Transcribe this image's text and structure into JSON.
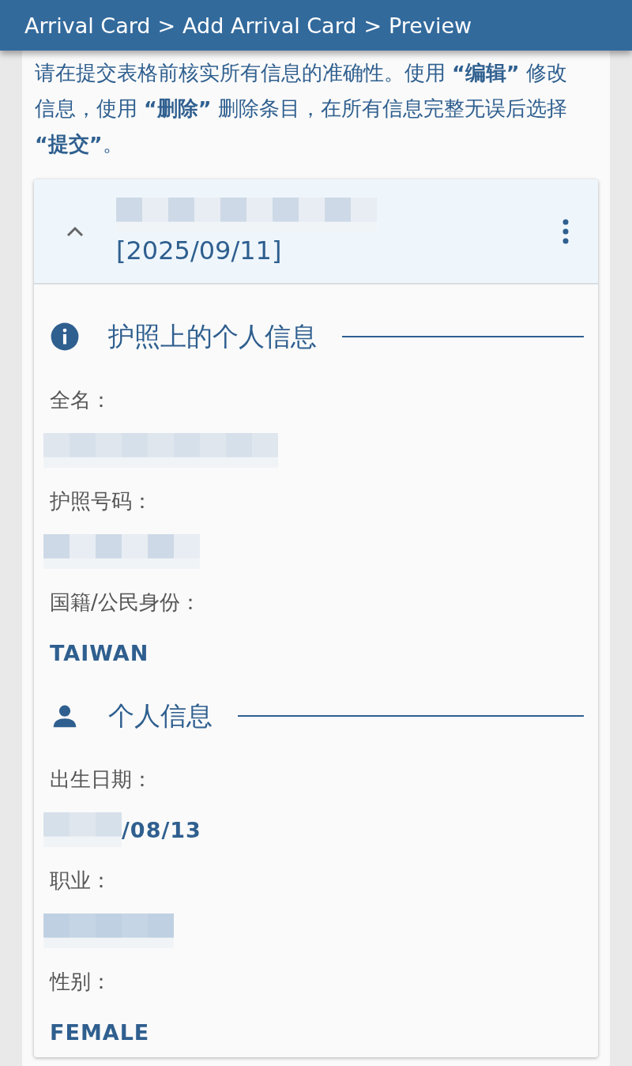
{
  "breadcrumb": {
    "items": [
      {
        "label": "Arrival Card"
      },
      {
        "label": "Add Arrival Card"
      },
      {
        "label": "Preview"
      }
    ],
    "separator": ">"
  },
  "intro": "请在提交表格前核实所有信息的准确性。使用 **“编辑”** 修改信息，使用 **“删除”** 删除条目，在所有信息完整无误后选择 **“提交”**。",
  "card": {
    "expanded": true,
    "date": "[2025/09/11]",
    "sections": [
      {
        "title": "护照上的个人信息",
        "fields": [
          {
            "label": "全名：",
            "kind": "redacted"
          },
          {
            "label": "护照号码：",
            "kind": "redacted"
          },
          {
            "label": "国籍/公民身份：",
            "kind": "text",
            "value": "TAIWAN"
          }
        ]
      },
      {
        "title": "个人信息",
        "fields": [
          {
            "label": "出生日期：",
            "kind": "partly_redacted",
            "value": "/08/13"
          },
          {
            "label": "职业：",
            "kind": "redacted"
          },
          {
            "label": "性别：",
            "kind": "text",
            "value": "FEMALE"
          }
        ]
      }
    ]
  }
}
